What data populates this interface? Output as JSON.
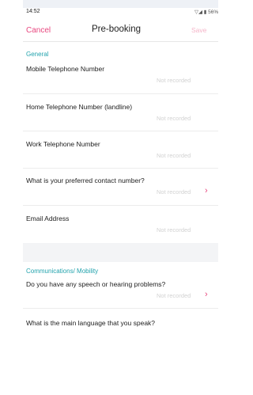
{
  "status": {
    "time": "14:52",
    "right": "▽◢ ▮ 56%"
  },
  "nav": {
    "cancel": "Cancel",
    "title": "Pre-booking",
    "save": "Save"
  },
  "sections": {
    "general": {
      "title": "General",
      "fields": [
        {
          "label": "Mobile Telephone Number",
          "value": "Not recorded"
        },
        {
          "label": "Home Telephone Number (landline)",
          "value": "Not recorded"
        },
        {
          "label": "Work Telephone Number",
          "value": "Not recorded"
        },
        {
          "label": "What is your preferred contact number?",
          "value": "Not recorded"
        },
        {
          "label": "Email Address",
          "value": "Not recorded"
        }
      ]
    },
    "communications": {
      "title": "Communications/ Mobility",
      "fields": [
        {
          "label": "Do you have any speech or hearing problems?",
          "value": "Not recorded"
        },
        {
          "label": "What is the main language that you speak?"
        }
      ]
    }
  },
  "icons": {
    "chevron": "›"
  },
  "colors": {
    "accent": "#e8477f",
    "section": "#23a3ad",
    "placeholder": "#d2d2d2"
  }
}
